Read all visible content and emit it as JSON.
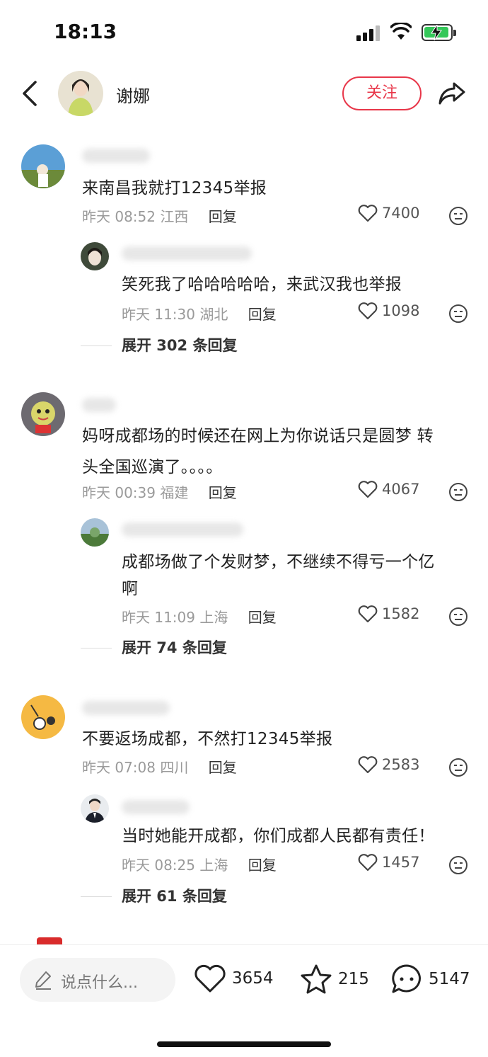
{
  "status": {
    "time": "18:13"
  },
  "header": {
    "author": "谢娜",
    "follow_label": "关注"
  },
  "comments": [
    {
      "text": "来南昌我就打12345举报",
      "time": "昨天 08:52",
      "location": "江西",
      "reply_label": "回复",
      "likes": "7400",
      "sub": {
        "text": "笑死我了哈哈哈哈哈，来武汉我也举报",
        "time": "昨天 11:30",
        "location": "湖北",
        "reply_label": "回复",
        "likes": "1098"
      },
      "expand_label": "展开 302 条回复"
    },
    {
      "text_line1": "妈呀成都场的时候还在网上为你说话只是圆梦 转",
      "text_line2": "头全国巡演了。。。。",
      "time": "昨天 00:39",
      "location": "福建",
      "reply_label": "回复",
      "likes": "4067",
      "sub": {
        "text_line1": "成都场做了个发财梦，不继续不得亏一个亿",
        "text_line2": "啊",
        "time": "昨天 11:09",
        "location": "上海",
        "reply_label": "回复",
        "likes": "1582"
      },
      "expand_label": "展开 74 条回复"
    },
    {
      "text": "不要返场成都，不然打12345举报",
      "time": "昨天 07:08",
      "location": "四川",
      "reply_label": "回复",
      "likes": "2583",
      "sub": {
        "text": "当时她能开成都，你们成都人民都有责任！",
        "time": "昨天 08:25",
        "location": "上海",
        "reply_label": "回复",
        "likes": "1457"
      },
      "expand_label": "展开 61 条回复"
    }
  ],
  "bottom": {
    "input_placeholder": "说点什么...",
    "likes": "3654",
    "favorites": "215",
    "comments": "5147"
  },
  "colors": {
    "accent": "#e8374a",
    "meta": "#9a9a9a",
    "battery": "#34c759"
  },
  "icons": [
    "back-icon",
    "share-icon",
    "heart-icon",
    "dislike-icon",
    "pencil-icon",
    "star-icon",
    "chat-icon"
  ]
}
